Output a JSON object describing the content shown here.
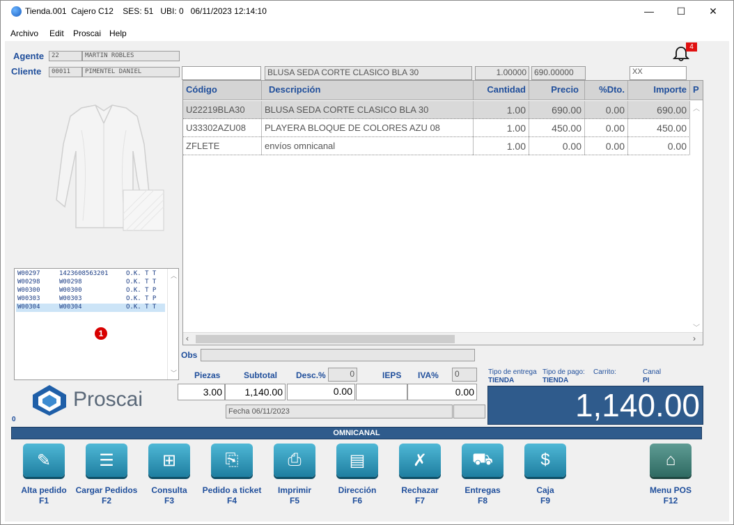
{
  "window": {
    "title": "Tienda.001  Cajero C12    SES: 51   UBI: 0   06/11/2023 12:14:10",
    "minimize": "—",
    "maximize": "☐",
    "close": "✕"
  },
  "menu": [
    "Archivo",
    "Edit",
    "Proscai",
    "Help"
  ],
  "notifications": {
    "count": "4"
  },
  "agente": {
    "label": "Agente",
    "code": "22",
    "name": "MARTIN ROBLES"
  },
  "cliente": {
    "label": "Cliente",
    "code": "00011",
    "name": "PIMENTEL DANIEL"
  },
  "entry": {
    "code": "",
    "description": "BLUSA SEDA CORTE CLASICO BLA 30",
    "quantity": "1.00000",
    "price": "690.00000",
    "extra": "XX"
  },
  "table": {
    "headers": [
      "Código",
      "Descripción",
      "Cantidad",
      "Precio",
      "%Dto.",
      "Importe",
      "P"
    ],
    "rows": [
      [
        "U22219BLA30",
        "BLUSA SEDA CORTE CLASICO BLA 30",
        "1.00",
        "690.00",
        "0.00",
        "690.00"
      ],
      [
        "U33302AZU08",
        "PLAYERA BLOQUE DE COLORES AZU 08",
        "1.00",
        "450.00",
        "0.00",
        "450.00"
      ],
      [
        "ZFLETE",
        "envíos omnicanal",
        "1.00",
        "0.00",
        "0.00",
        "0.00"
      ]
    ]
  },
  "orders": [
    [
      "W00297",
      "1423608563201",
      "O.K. T T"
    ],
    [
      "W00298",
      "W00298",
      "O.K. T T"
    ],
    [
      "W00300",
      "W00300",
      "O.K. T P"
    ],
    [
      "W00303",
      "W00303",
      "O.K. T P"
    ],
    [
      "W00304",
      "W00304",
      "O.K. T T"
    ]
  ],
  "orders_badge": "1",
  "obs_label": "Obs",
  "totals": {
    "piezas_label": "Piezas",
    "subtotal_label": "Subtotal",
    "desc_label": "Desc.%",
    "desc_pct": "0",
    "ieps_label": "IEPS",
    "iva_label": "IVA%",
    "iva_pct": "0",
    "piezas": "3.00",
    "subtotal": "1,140.00",
    "descuento": "0.00",
    "ieps": "",
    "iva": "0.00",
    "fecha": "Fecha 06/11/2023",
    "total": "1,140.00"
  },
  "entrega": {
    "tipo_entrega_label": "Tipo de entrega",
    "tipo_pago_label": "Tipo de pago:",
    "carrito_label": "Carrito:",
    "canal_label": "Canal",
    "tipo_entrega": "TIENDA",
    "tipo_pago": "TIENDA",
    "canal": "PI"
  },
  "logo_text": "Proscai",
  "status_zero": "0",
  "banner": "OMNICANAL",
  "buttons": [
    {
      "label": "Alta pedido",
      "key": "F1",
      "icon": "pencil-icon",
      "glyph": "✎"
    },
    {
      "label": "Cargar Pedidos",
      "key": "F2",
      "icon": "list-icon",
      "glyph": "☰"
    },
    {
      "label": "Consulta",
      "key": "F3",
      "icon": "grid-search-icon",
      "glyph": "⊞"
    },
    {
      "label": "Pedido a ticket",
      "key": "F4",
      "icon": "ticket-icon",
      "glyph": "⎘"
    },
    {
      "label": "Imprimir",
      "key": "F5",
      "icon": "printer-icon",
      "glyph": "⎙"
    },
    {
      "label": "Dirección",
      "key": "F6",
      "icon": "address-card-icon",
      "glyph": "▤"
    },
    {
      "label": "Rechazar",
      "key": "F7",
      "icon": "reject-icon",
      "glyph": "✗"
    },
    {
      "label": "Entregas",
      "key": "F8",
      "icon": "truck-icon",
      "glyph": "⛟"
    },
    {
      "label": "Caja",
      "key": "F9",
      "icon": "cash-icon",
      "glyph": "$"
    },
    {
      "label": "Menu POS",
      "key": "F12",
      "icon": "home-icon",
      "glyph": "⌂"
    }
  ]
}
